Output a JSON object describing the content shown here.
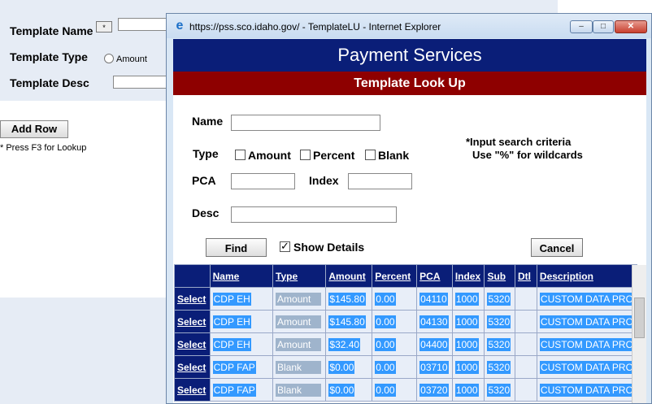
{
  "background": {
    "template_name_label": "Template Name",
    "lookup_button": "*",
    "template_type_label": "Template Type",
    "type_amount": "Amount",
    "template_desc_label": "Template Desc",
    "add_row_label": "Add Row",
    "f3_hint": "* Press F3 for Lookup"
  },
  "window": {
    "title": "https://pss.sco.idaho.gov/ - TemplateLU - Internet Explorer",
    "ie_icon": "ie-logo-icon",
    "minimize": "–",
    "maximize": "□",
    "close": "✕"
  },
  "page": {
    "header": "Payment Services",
    "subheader": "Template Look Up",
    "name_label": "Name",
    "type_label": "Type",
    "type_amount": "Amount",
    "type_percent": "Percent",
    "type_blank": "Blank",
    "pca_label": "PCA",
    "index_label": "Index",
    "desc_label": "Desc",
    "hint_line1": "*Input search criteria",
    "hint_line2": "Use \"%\" for wildcards",
    "find_label": "Find",
    "show_details_label": "Show Details",
    "cancel_label": "Cancel"
  },
  "table": {
    "headers": [
      "Name",
      "Type",
      "Amount",
      "Percent",
      "PCA",
      "Index",
      "Sub",
      "Dtl",
      "Description"
    ],
    "select_label": "Select",
    "rows": [
      {
        "name": "CDP EH",
        "type": "Amount",
        "amount": "$145.80",
        "percent": "0.00",
        "pca": "04110",
        "index": "1000",
        "sub": "5320",
        "dtl": "",
        "desc": "CUSTOM DATA PRO"
      },
      {
        "name": "CDP EH",
        "type": "Amount",
        "amount": "$145.80",
        "percent": "0.00",
        "pca": "04130",
        "index": "1000",
        "sub": "5320",
        "dtl": "",
        "desc": "CUSTOM DATA PRO"
      },
      {
        "name": "CDP EH",
        "type": "Amount",
        "amount": "$32.40",
        "percent": "0.00",
        "pca": "04400",
        "index": "1000",
        "sub": "5320",
        "dtl": "",
        "desc": "CUSTOM DATA PRO"
      },
      {
        "name": "CDP FAP",
        "type": "Blank",
        "amount": "$0.00",
        "percent": "0.00",
        "pca": "03710",
        "index": "1000",
        "sub": "5320",
        "dtl": "",
        "desc": "CUSTOM DATA PRO"
      },
      {
        "name": "CDP FAP",
        "type": "Blank",
        "amount": "$0.00",
        "percent": "0.00",
        "pca": "03720",
        "index": "1000",
        "sub": "5320",
        "dtl": "",
        "desc": "CUSTOM DATA PRO"
      }
    ]
  }
}
